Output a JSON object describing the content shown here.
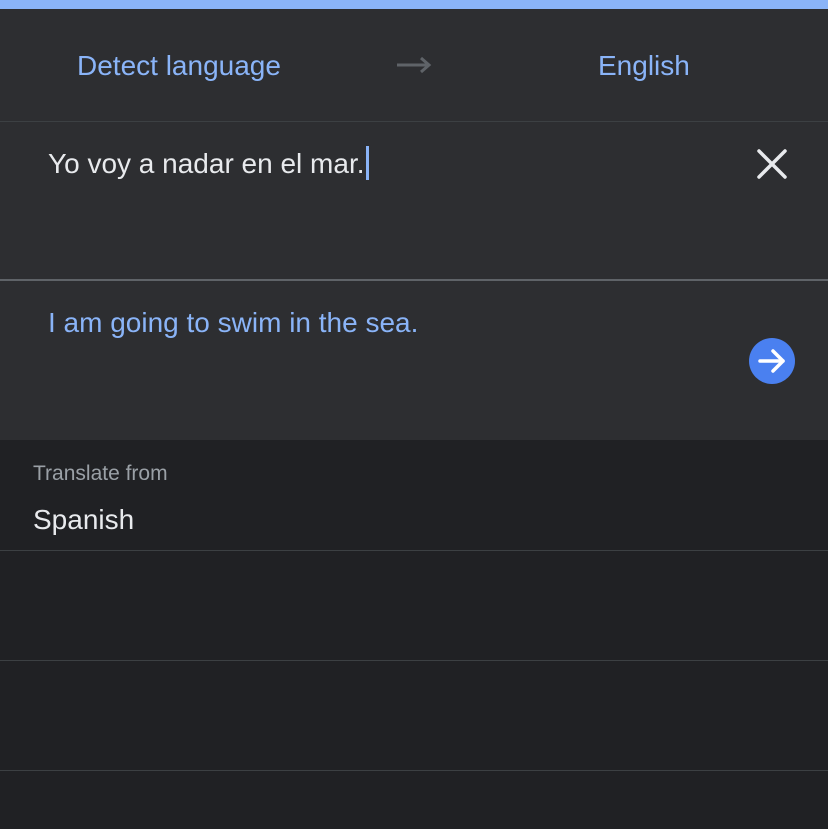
{
  "language_bar": {
    "source_language": "Detect language",
    "target_language": "English",
    "swap_icon": "arrow-right-icon"
  },
  "input": {
    "text": "Yo voy a nadar en el mar.",
    "clear_icon": "close-icon"
  },
  "output": {
    "text": "I am going to swim in the sea.",
    "go_icon": "arrow-right-circle-icon"
  },
  "translate_from": {
    "label": "Translate from",
    "suggestions": [
      "Spanish",
      "",
      ""
    ]
  },
  "colors": {
    "accent": "#8ab4f8",
    "button": "#4a80f0",
    "panel": "#2d2e31",
    "background": "#202124"
  }
}
